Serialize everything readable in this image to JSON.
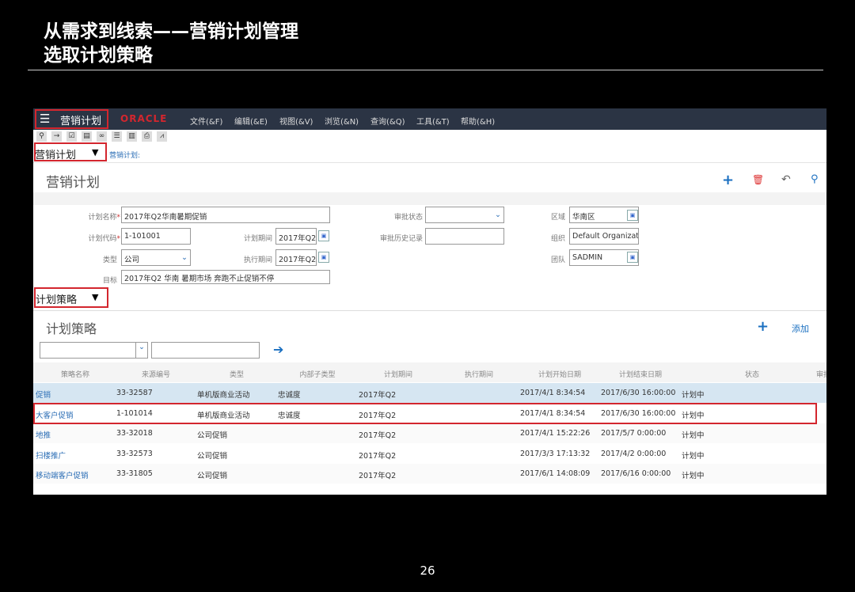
{
  "slide": {
    "title_line1": "从需求到线索——营销计划管理",
    "title_line2": "选取计划策略",
    "page_number": "26"
  },
  "app": {
    "menu_title": "营销计划",
    "logo": "ORACLE",
    "menus": [
      "文件(&F)",
      "编辑(&E)",
      "视图(&V)",
      "浏览(&N)",
      "查询(&Q)",
      "工具(&T)",
      "帮助(&H)"
    ],
    "view_selector": "营销计划",
    "breadcrumb": "营销计划:",
    "page_title": "营销计划",
    "section_selector": "计划策略"
  },
  "form": {
    "plan_name_label": "计划名称",
    "plan_name": "2017年Q2华南暑期促销",
    "plan_code_label": "计划代码",
    "plan_code": "1-101001",
    "type_label": "类型",
    "type": "公司",
    "goal_label": "目标",
    "goal": "2017年Q2 华南 暑期市场 奔跑不止促销不停",
    "plan_period_label": "计划期间",
    "plan_period": "2017年Q2",
    "exec_period_label": "执行期间",
    "exec_period": "2017年Q2",
    "approval_status_label": "审批状态",
    "approval_status": "",
    "approval_history_label": "审批历史记录",
    "approval_history": "",
    "region_label": "区域",
    "region": "华南区",
    "org_label": "组织",
    "org": "Default Organization",
    "team_label": "团队",
    "team": "SADMIN"
  },
  "strategies": {
    "title": "计划策略",
    "add_label": "添加",
    "columns": [
      "策略名称",
      "来源编号",
      "类型",
      "内部子类型",
      "计划期间",
      "执行期间",
      "计划开始日期",
      "计划结束日期",
      "",
      "状态",
      "审批"
    ],
    "rows": [
      {
        "name": "促销",
        "source": "33-32587",
        "type": "单机版商业活动",
        "subtype": "忠诚度",
        "period": "2017年Q2",
        "exec": "",
        "start": "2017/4/1 8:34:54",
        "end": "2017/6/30 16:00:00",
        "status": "计划中"
      },
      {
        "name": "大客户促销",
        "source": "1-101014",
        "type": "单机版商业活动",
        "subtype": "忠诚度",
        "period": "2017年Q2",
        "exec": "",
        "start": "2017/4/1 8:34:54",
        "end": "2017/6/30 16:00:00",
        "status": "计划中"
      },
      {
        "name": "地推",
        "source": "33-32018",
        "type": "公司促销",
        "subtype": "",
        "period": "2017年Q2",
        "exec": "",
        "start": "2017/4/1 15:22:26",
        "end": "2017/5/7 0:00:00",
        "status": "计划中"
      },
      {
        "name": "扫楼推广",
        "source": "33-32573",
        "type": "公司促销",
        "subtype": "",
        "period": "2017年Q2",
        "exec": "",
        "start": "2017/3/3 17:13:32",
        "end": "2017/4/2 0:00:00",
        "status": "计划中"
      },
      {
        "name": "移动端客户促销",
        "source": "33-31805",
        "type": "公司促销",
        "subtype": "",
        "period": "2017年Q2",
        "exec": "",
        "start": "2017/6/1 14:08:09",
        "end": "2017/6/16 0:00:00",
        "status": "计划中"
      }
    ]
  },
  "colors": {
    "nav": "#2b3444",
    "highlight_box": "#d3262e",
    "selected_row": "#d6e6f2",
    "link": "#2a6db5",
    "accent": "#1a6fc0"
  }
}
